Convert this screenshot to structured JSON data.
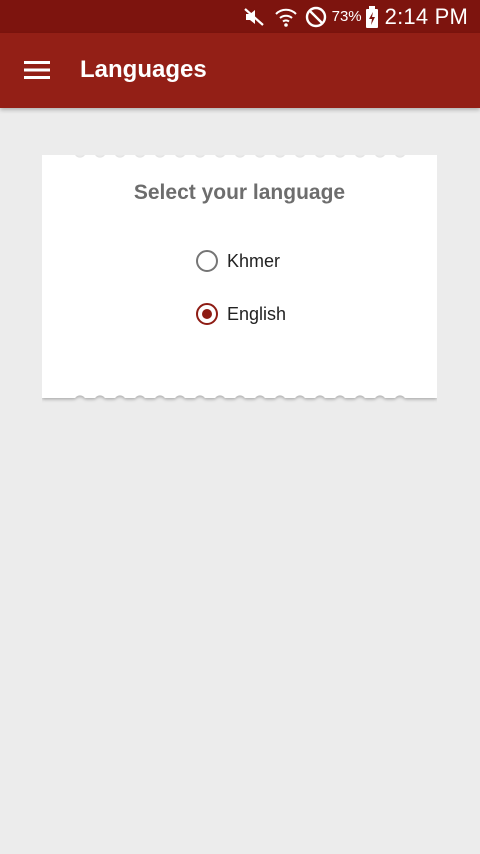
{
  "status_bar": {
    "battery_percent": "73%",
    "time": "2:14 PM",
    "icons": [
      "mute-icon",
      "wifi-icon",
      "do-not-disturb-icon",
      "battery-charging-icon"
    ]
  },
  "app_bar": {
    "menu_icon": "hamburger-menu-icon",
    "title": "Languages"
  },
  "card": {
    "title": "Select your language",
    "options": [
      {
        "label": "Khmer",
        "selected": false
      },
      {
        "label": "English",
        "selected": true
      }
    ]
  },
  "colors": {
    "status_bar": "#7d140e",
    "app_bar": "#931f16",
    "accent": "#8e1c14",
    "background": "#ececec",
    "card": "#ffffff"
  }
}
